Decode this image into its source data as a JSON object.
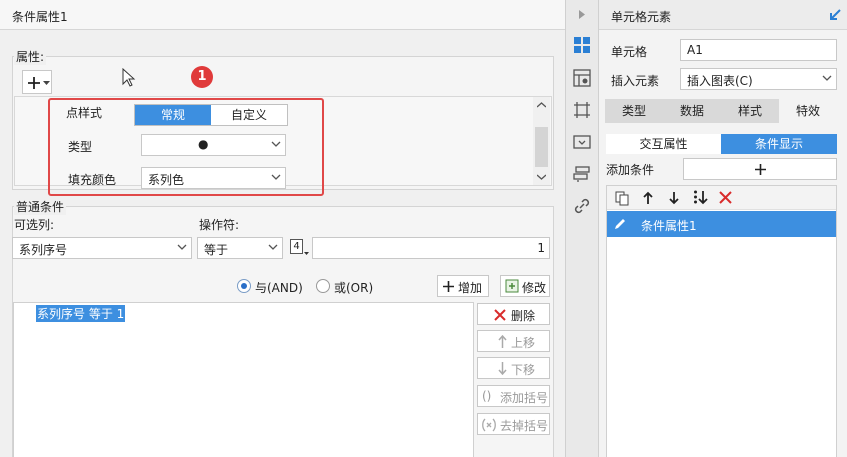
{
  "dialog": {
    "title": "条件属性1",
    "properties_label": "属性:",
    "point_style": {
      "label": "点样式",
      "options": [
        "常规",
        "自定义"
      ],
      "selected": "常规",
      "type_label": "类型",
      "type_value": "●",
      "fill_label": "填充颜色",
      "fill_value": "系列色"
    },
    "badge": "1",
    "common": {
      "group_label": "普通条件",
      "column_label": "可选列:",
      "column_value": "系列序号",
      "operator_label": "操作符:",
      "operator_value": "等于",
      "type_icon_text": "4",
      "value": "1",
      "and_label": "与(AND)",
      "or_label": "或(OR)",
      "add_label": "增加",
      "modify_label": "修改",
      "condition_item": "系列序号 等于 1",
      "delete_label": "删除",
      "up_label": "上移",
      "down_label": "下移",
      "add_bracket_label": "添加括号",
      "remove_bracket_label": "去掉括号"
    }
  },
  "right_panel": {
    "title": "单元格元素",
    "cell_label": "单元格",
    "cell_value": "A1",
    "insert_label": "插入元素",
    "insert_value": "插入图表(C)",
    "tabs": [
      "类型",
      "数据",
      "样式",
      "特效"
    ],
    "active_tab": "特效",
    "sub_tabs": [
      "交互属性",
      "条件显示"
    ],
    "active_sub_tab": "条件显示",
    "add_condition_label": "添加条件",
    "list_items": [
      "条件属性1"
    ]
  },
  "colors": {
    "accent": "#3d8fe0",
    "highlight_border": "#e04848",
    "badge": "#e03a3a"
  }
}
